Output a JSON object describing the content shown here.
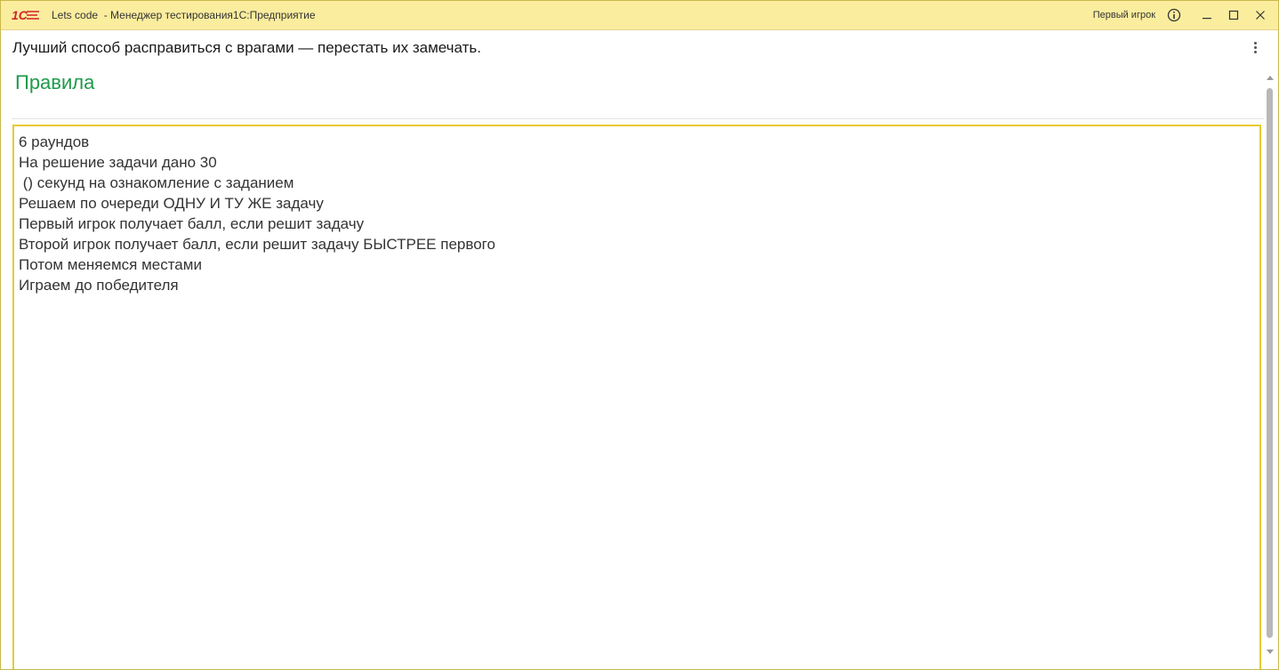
{
  "window": {
    "title": "Lets code  - Менеджер тестирования1С:Предприятие",
    "user": "Первый игрок",
    "accent_color": "#fbed9e",
    "logo_text": "1С"
  },
  "header": {
    "quote": "Лучший способ расправиться с врагами — перестать их замечать.",
    "section_title": "Правила",
    "section_title_color": "#1e9a4a"
  },
  "rules": {
    "lines": [
      "6 раундов",
      "На решение задачи дано 30",
      " () секунд на ознакомление с заданием",
      "Решаем по очереди ОДНУ И ТУ ЖЕ задачу",
      "Первый игрок получает балл, если решит задачу",
      "Второй игрок получает балл, если решит задачу БЫСТРЕЕ первого",
      "Потом меняемся местами",
      "Играем до победителя"
    ],
    "border_color": "#e8cb2e"
  },
  "icons": {
    "logo": "1c-logo-icon",
    "info": "info-icon",
    "minimize": "minimize-icon",
    "maximize": "maximize-icon",
    "close": "close-icon",
    "more": "more-vertical-icon"
  }
}
